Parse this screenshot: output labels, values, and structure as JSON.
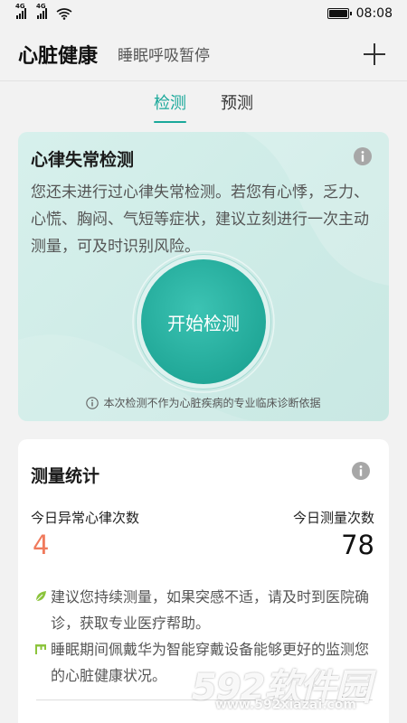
{
  "status_bar": {
    "signal_1": "4G",
    "signal_2": "4G",
    "time": "08:08"
  },
  "header": {
    "title": "心脏健康",
    "subtitle": "睡眠呼吸暂停",
    "add_icon": "plus-icon"
  },
  "tabs": [
    {
      "label": "检测",
      "active": true
    },
    {
      "label": "预测",
      "active": false
    }
  ],
  "arrhythmia_card": {
    "title": "心律失常检测",
    "description": "您还未进行过心律失常检测。若您有心悸，乏力、心慌、胸闷、气短等症状，建议立刻进行一次主动测量，可及时识别风险。",
    "button_label": "开始检测",
    "disclaimer": "本次检测不作为心脏疾病的专业临床诊断依据"
  },
  "stats_card": {
    "title": "测量统计",
    "abnormal_label": "今日异常心律次数",
    "abnormal_value": "4",
    "count_label": "今日测量次数",
    "count_value": "78",
    "tips": [
      {
        "icon": "leaf-icon",
        "text": "建议您持续测量，如果突感不适，请及时到医院确诊，获取专业医疗帮助。"
      },
      {
        "icon": "flag-icon",
        "text": "睡眠期间佩戴华为智能穿戴设备能够更好的监测您的心脏健康状况。"
      }
    ]
  },
  "watermark": {
    "brand": "592软件园",
    "url": "www.592xiazai.com"
  },
  "colors": {
    "accent": "#1aa89a",
    "alert": "#f07a5c",
    "tip_green": "#8cc43c"
  }
}
